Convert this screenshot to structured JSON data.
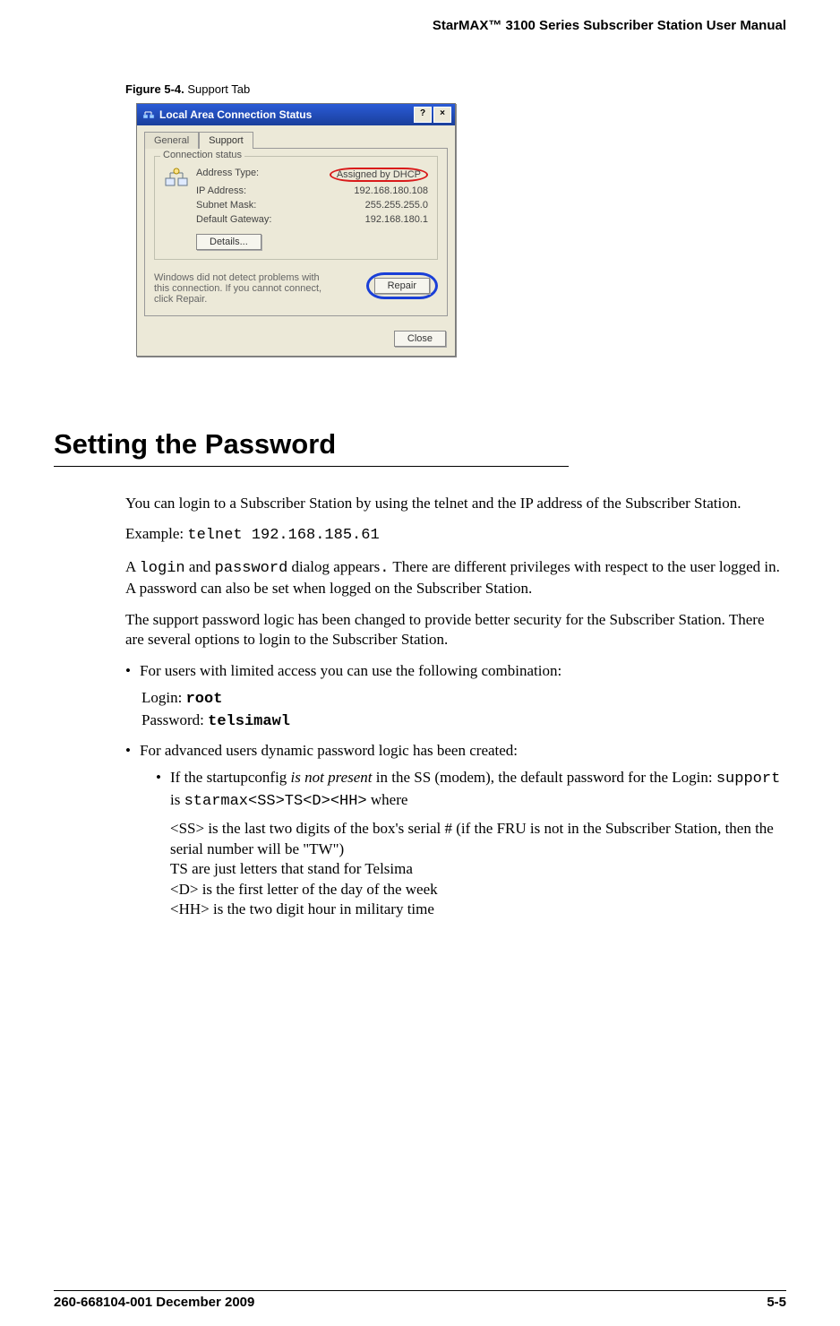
{
  "header": {
    "title": "StarMAX™ 3100 Series Subscriber Station User Manual"
  },
  "figure": {
    "number": "Figure 5-4.",
    "title": " Support Tab"
  },
  "dialog": {
    "title": "Local Area Connection Status",
    "help_btn": "?",
    "close_btn": "×",
    "tabs": {
      "general": "General",
      "support": "Support"
    },
    "fieldset_legend": "Connection status",
    "rows": {
      "addr_type_label": "Address Type:",
      "addr_type_value": "Assigned by DHCP",
      "ip_label": "IP Address:",
      "ip_value": "192.168.180.108",
      "mask_label": "Subnet Mask:",
      "mask_value": "255.255.255.0",
      "gw_label": "Default Gateway:",
      "gw_value": "192.168.180.1"
    },
    "details_btn": "Details...",
    "repair_msg": "Windows did not detect problems with this connection. If you cannot connect, click Repair.",
    "repair_btn": "Repair",
    "close_btn_bottom": "Close"
  },
  "section": {
    "heading": "Setting the Password"
  },
  "body": {
    "p1": "You can login to a Subscriber Station by using the telnet and the IP address of the Subscriber Station.",
    "p2_prefix": "Example: ",
    "p2_code": "telnet 192.168.185.61",
    "p3_a": "A ",
    "p3_login": "login",
    "p3_b": " and ",
    "p3_password": "password",
    "p3_c": " dialog appears",
    "p3_dot": ".",
    "p3_d": "  There are different privileges with respect to the user logged in. A password can also be set when logged on the Subscriber Station.",
    "p4": "The support password logic has been changed to provide better security for the Subscriber Station. There are several options to login to the Subscriber Station.",
    "li1": "For users with limited access you can use the following combination:",
    "login_label": "Login: ",
    "login_value": "root",
    "password_label": "Password: ",
    "password_value": "telsimawl",
    "li2": "For advanced users dynamic password logic has been created:",
    "li2a_a": "If the startupconfig ",
    "li2a_italic": "is not present",
    "li2a_b": " in the SS (modem), the default password for the Login: ",
    "li2a_code1": "support",
    "li2a_c": " is ",
    "li2a_code2": "starmax<SS>TS<D><HH>",
    "li2a_d": " where",
    "explain_ss": "<SS> is the last two digits of the box's serial # (if the FRU is not in the Subscriber Station, then the serial number will be \"TW\")",
    "explain_ts": "TS are just letters that stand for Telsima",
    "explain_d": "<D> is the first letter of the day of the week",
    "explain_hh": "<HH> is the two digit hour in military time"
  },
  "footer": {
    "left": "260-668104-001 December 2009",
    "right": "5-5"
  }
}
